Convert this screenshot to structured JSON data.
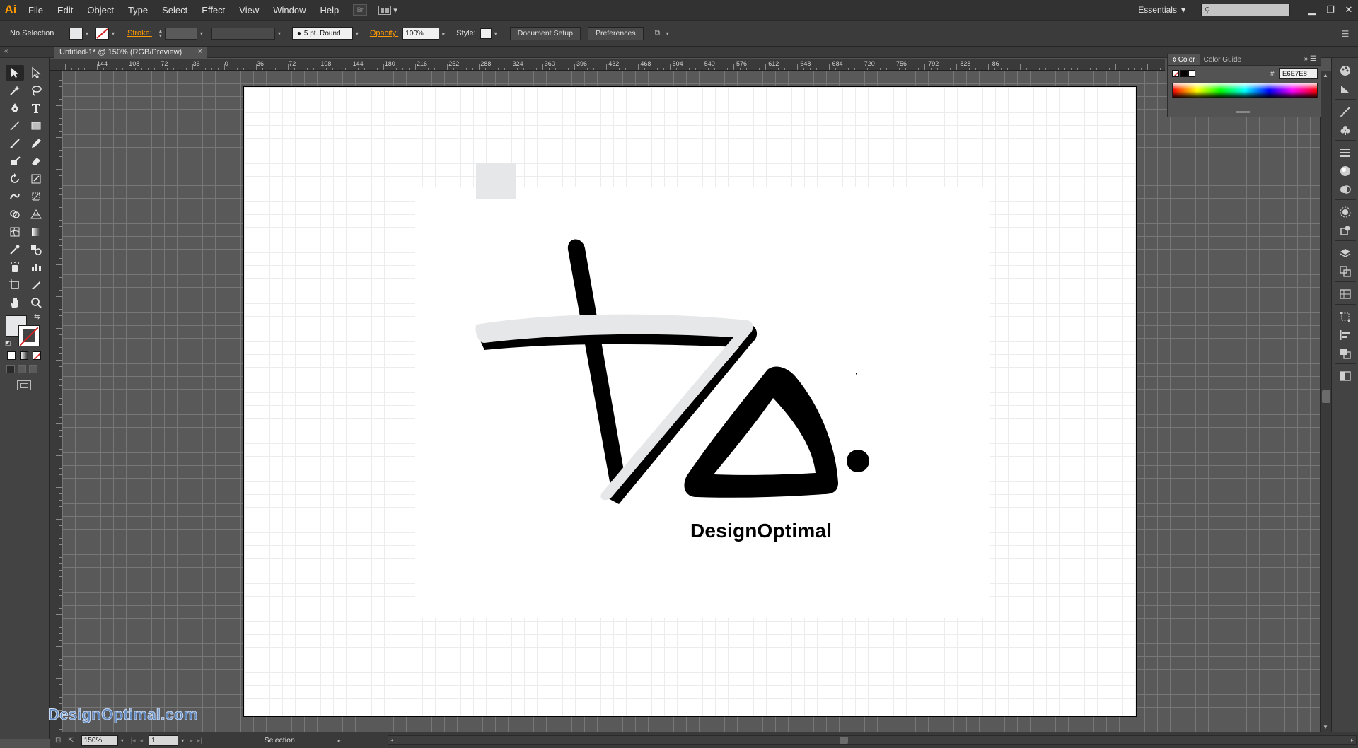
{
  "app": {
    "logo": "Ai"
  },
  "menu": {
    "items": [
      "File",
      "Edit",
      "Object",
      "Type",
      "Select",
      "Effect",
      "View",
      "Window",
      "Help"
    ]
  },
  "workspace": {
    "name": "Essentials"
  },
  "control_bar": {
    "selection_status": "No Selection",
    "stroke_label": "Stroke:",
    "brush": "5 pt. Round",
    "opacity_label": "Opacity:",
    "opacity_value": "100%",
    "style_label": "Style:",
    "document_setup": "Document Setup",
    "preferences": "Preferences"
  },
  "document": {
    "tab_title": "Untitled-1* @ 150% (RGB/Preview)"
  },
  "rulers": {
    "top_labels": [
      "144",
      "108",
      "72",
      "36",
      "0",
      "36",
      "72",
      "108",
      "144",
      "180",
      "216",
      "252",
      "288",
      "324",
      "360",
      "396",
      "432",
      "468",
      "504",
      "540",
      "576",
      "612",
      "648",
      "684",
      "720",
      "756",
      "792",
      "828",
      "86"
    ]
  },
  "color_panel": {
    "tabs": [
      "Color",
      "Color Guide"
    ],
    "hex_label": "#",
    "hex_value": "E6E7E8",
    "fill_color": "#e6e7e8"
  },
  "artwork": {
    "brand_name": "DesignOptimal",
    "watermark": "DesignOptimal.com"
  },
  "status_bar": {
    "zoom": "150%",
    "page": "1",
    "mode": "Selection"
  },
  "colors": {
    "accent": "#ff9a00",
    "app_background": "#535353",
    "artboard": "#ffffff",
    "stroke_none": "#d62020"
  }
}
